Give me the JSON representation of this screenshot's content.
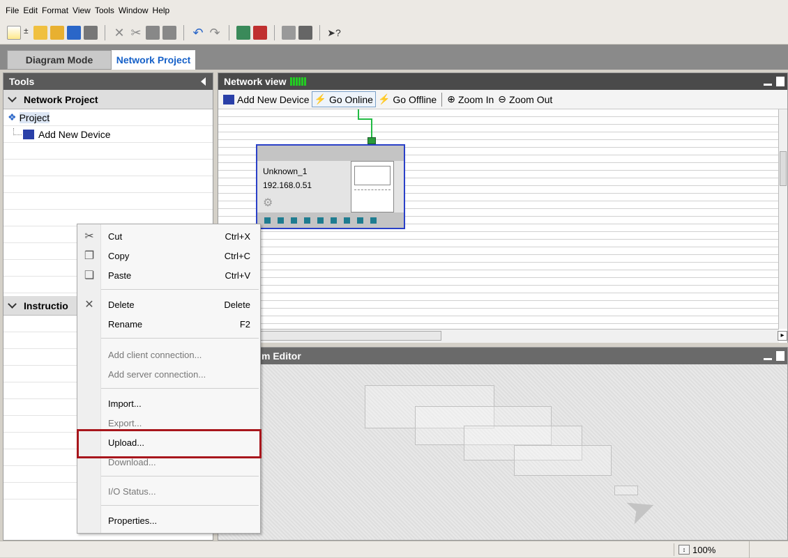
{
  "menubar": [
    "File",
    "Edit",
    "Format",
    "View",
    "Tools",
    "Window",
    "Help"
  ],
  "tabs": {
    "diagram": "Diagram Mode",
    "network": "Network Project"
  },
  "tools": {
    "header": "Tools",
    "network_section": "Network Project",
    "tree": {
      "root": "Project",
      "child": "Add New Device"
    },
    "instructions_section": "Instructio"
  },
  "network_view": {
    "title": "Network view",
    "toolbar": {
      "add_device": "Add New Device",
      "go_online": "Go Online",
      "go_offline": "Go Offline",
      "zoom_in": "Zoom In",
      "zoom_out": "Zoom Out"
    },
    "device": {
      "name": "Unknown_1",
      "ip": "192.168.0.51"
    }
  },
  "program_editor": {
    "title": "m Editor"
  },
  "context_menu": {
    "items": [
      {
        "label": "Cut",
        "shortcut": "Ctrl+X",
        "icon": "scissors-icon"
      },
      {
        "label": "Copy",
        "shortcut": "Ctrl+C",
        "icon": "copy-icon"
      },
      {
        "label": "Paste",
        "shortcut": "Ctrl+V",
        "icon": "paste-icon"
      },
      {
        "label": "Delete",
        "shortcut": "Delete",
        "icon": "delete-x-icon"
      },
      {
        "label": "Rename",
        "shortcut": "F2"
      },
      {
        "label": "Add client connection..."
      },
      {
        "label": "Add server connection..."
      },
      {
        "label": "Import..."
      },
      {
        "label": "Export..."
      },
      {
        "label": "Upload..."
      },
      {
        "label": "Download..."
      },
      {
        "label": "I/O Status..."
      },
      {
        "label": "Properties..."
      }
    ]
  },
  "status": {
    "zoom": "100%"
  },
  "colors": {
    "highlight": "#a8161c",
    "device_border": "#2a40c8",
    "port": "#1f7c90",
    "active_tab": "#1560c8"
  }
}
